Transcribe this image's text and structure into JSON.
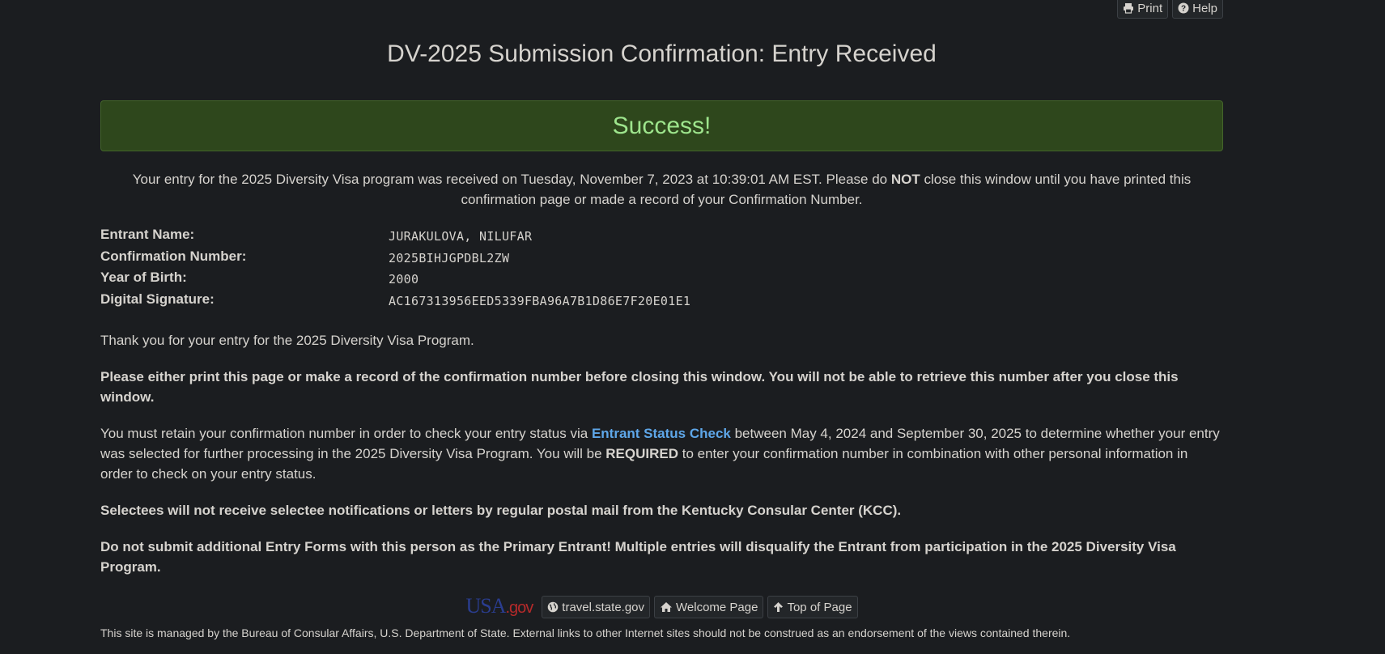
{
  "header": {
    "print_label": "Print",
    "help_label": "Help",
    "title": "DV-2025 Submission Confirmation: Entry Received"
  },
  "alert": {
    "text": "Success!"
  },
  "intro": {
    "part1": "Your entry for the 2025 Diversity Visa program was received on Tuesday, November 7, 2023 at 10:39:01 AM EST. Please do ",
    "emphasis": "NOT",
    "part2": " close this window until you have printed this confirmation page or made a record of your Confirmation Number."
  },
  "entrant": {
    "name_label": "Entrant Name:",
    "name_value": "JURAKULOVA, NILUFAR",
    "confirmation_label": "Confirmation Number:",
    "confirmation_value": "2025BIHJGPDBL2ZW",
    "birth_label": "Year of Birth:",
    "birth_value": "2000",
    "signature_label": "Digital Signature:",
    "signature_value": "AC167313956EED5339FBA96A7B1D86E7F20E01E1"
  },
  "body": {
    "thanks": "Thank you for your entry for the 2025 Diversity Visa Program.",
    "print_notice": "Please either print this page or make a record of the confirmation number before closing this window. You will not be able to retrieve this number after you close this window.",
    "retain_part1": "You must retain your confirmation number in order to check your entry status via ",
    "status_link": "Entrant Status Check",
    "retain_part2": " between May 4, 2024 and September 30, 2025 to determine whether your entry was selected for further processing in the 2025 Diversity Visa Program. You will be ",
    "retain_emphasis": "REQUIRED",
    "retain_part3": " to enter your confirmation number in combination with other personal information in order to check on your entry status.",
    "mail_notice": "Selectees will not receive selectee notifications or letters by regular postal mail from the Kentucky Consular Center (KCC).",
    "duplicate_notice": "Do not submit additional Entry Forms with this person as the Primary Entrant! Multiple entries will disqualify the Entrant from participation in the 2025 Diversity Visa Program."
  },
  "footer": {
    "logo_usa": "USA",
    "logo_gov": ".gov",
    "travel_label": "travel.state.gov",
    "welcome_label": "Welcome Page",
    "top_label": "Top of Page",
    "disclaimer": "This site is managed by the Bureau of Consular Affairs, U.S. Department of State. External links to other Internet sites should not be construed as an endorsement of the views contained therein."
  },
  "icons": {
    "print": "print-icon",
    "help": "question-circle-icon",
    "globe": "globe-icon",
    "home": "home-icon",
    "arrow_up": "arrow-up-icon"
  },
  "colors": {
    "background": "#1b1d20",
    "success_bg": "#2e471c",
    "success_text": "#9ee58d",
    "link": "#5ea6e8"
  }
}
